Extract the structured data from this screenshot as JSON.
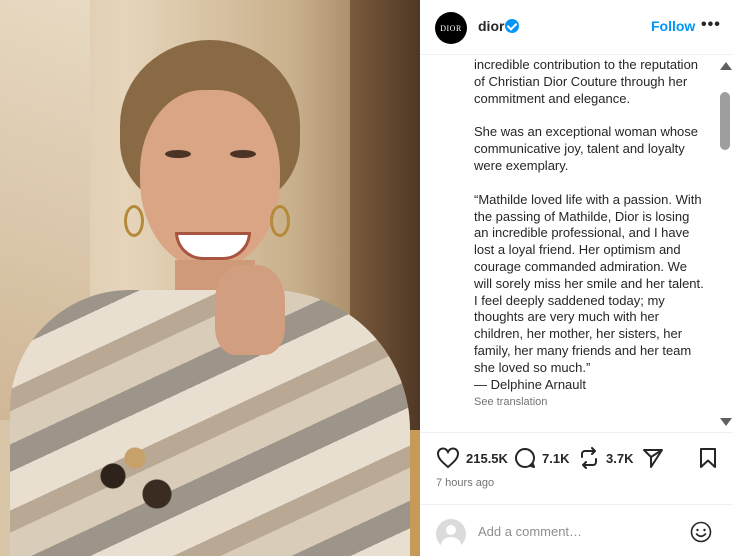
{
  "post": {
    "username": "dior",
    "logo_text": "DIOR",
    "follow_label": "Follow",
    "more_label": "•••",
    "caption": [
      "incredible contribution to the reputation of Christian Dior Couture through her commitment and elegance.",
      "She was an exceptional woman whose communicative joy, talent and loyalty were exemplary.",
      "“Mathilde loved life with a passion. With the passing of Mathilde, Dior is losing an incredible professional, and I have lost a loyal friend. Her optimism and courage commanded admiration. We will sorely miss her smile and her talent. I feel deeply saddened today; my thoughts are very much with her children, her mother, her sisters, her family, her many friends and her team she loved so much.”"
    ],
    "signature": "— Delphine Arnault",
    "see_translation": "See translation",
    "likes": "215.5K",
    "comments": "7.1K",
    "reposts": "3.7K",
    "time_ago": "7 hours ago",
    "comment_placeholder": "Add a comment…"
  },
  "icons": {
    "verified": "verified-badge-icon",
    "like": "heart-icon",
    "comment": "comment-bubble-icon",
    "repost": "repost-icon",
    "share": "paper-plane-icon",
    "save": "bookmark-icon",
    "emoji": "smiley-icon",
    "avatar": "user-avatar-icon"
  },
  "colors": {
    "accent": "#0095f6",
    "text": "#262626",
    "muted": "#737373"
  }
}
